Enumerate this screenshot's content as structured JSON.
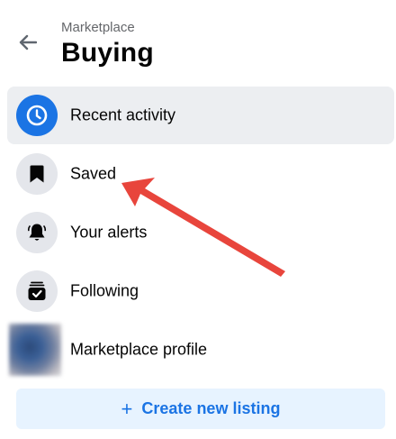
{
  "header": {
    "breadcrumb": "Marketplace",
    "title": "Buying",
    "back_icon": "arrow-left-icon"
  },
  "menu": {
    "items": [
      {
        "label": "Recent activity",
        "icon": "clock-icon",
        "active": true
      },
      {
        "label": "Saved",
        "icon": "bookmark-icon",
        "active": false
      },
      {
        "label": "Your alerts",
        "icon": "bell-icon",
        "active": false
      },
      {
        "label": "Following",
        "icon": "inbox-check-icon",
        "active": false
      },
      {
        "label": "Marketplace profile",
        "icon": "profile-avatar",
        "active": false
      }
    ]
  },
  "actions": {
    "create_label": "Create new listing",
    "create_icon": "plus-icon"
  },
  "colors": {
    "accent": "#1b74e4",
    "active_bg": "#eceef1",
    "icon_bg": "#e4e6eb",
    "button_bg": "#e7f3ff",
    "arrow_annotation": "#e8453c",
    "muted_text": "#65676b"
  }
}
